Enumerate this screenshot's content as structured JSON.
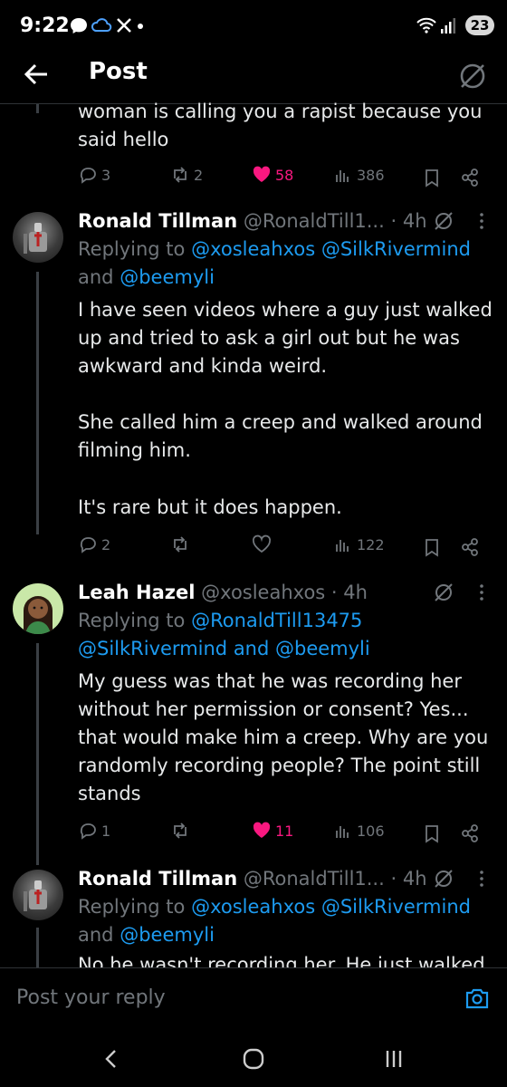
{
  "status_bar": {
    "time": "9:22",
    "battery": "23"
  },
  "header": {
    "title": "Post"
  },
  "top_post": {
    "text_line1": "woman is calling you a rapist because you",
    "text_line2": "said hello",
    "replies": "3",
    "reposts": "2",
    "likes": "58",
    "views": "386"
  },
  "posts": [
    {
      "name": "Ronald Tillman",
      "handle": "@RonaldTill1...",
      "time": "· 4h",
      "replying_prefix": "Replying to ",
      "reply_mentions": "@xosleahxos @SilkRivermind",
      "reply_and": "and ",
      "reply_last": "@beemyli",
      "lines": [
        "I have seen videos where a guy just walked",
        "up and tried to ask a girl out but he was",
        "awkward and kinda weird.",
        "She called him a creep and walked around",
        "filming him.",
        "It's rare but it does happen."
      ],
      "replies": "2",
      "reposts": "",
      "likes": "",
      "views": "122"
    },
    {
      "name": "Leah Hazel",
      "handle": "@xosleahxos",
      "time": "· 4h",
      "replying_prefix": "Replying to ",
      "reply_mentions": "@RonaldTill13475",
      "reply_line2_a": "@SilkRivermind",
      "reply_line2_and": " and ",
      "reply_line2_b": "@beemyli",
      "lines": [
        "My guess was that he was recording her",
        "without her permission or consent? Yes...",
        "that would make him a creep. Why are you",
        "randomly recording people? The point still",
        "stands"
      ],
      "replies": "1",
      "reposts": "",
      "likes": "11",
      "views": "106"
    },
    {
      "name": "Ronald Tillman",
      "handle": "@RonaldTill1...",
      "time": "· 4h",
      "replying_prefix": "Replying to ",
      "reply_mentions": "@xosleahxos @SilkRivermind",
      "reply_and": "and ",
      "reply_last": "@beemyli",
      "lines": [
        "No he wasn't recording her. He just walked"
      ]
    }
  ],
  "reply_bar": {
    "placeholder": "Post your reply"
  },
  "colors": {
    "accent": "#1d9bf0",
    "like": "#f91880",
    "muted": "#71767b",
    "bg": "#000000"
  }
}
